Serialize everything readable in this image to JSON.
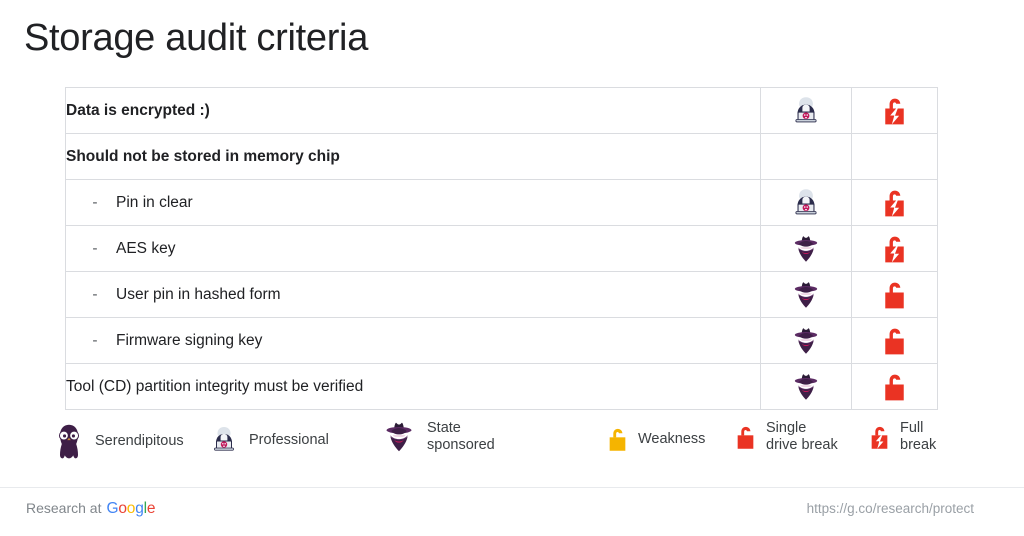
{
  "slide": {
    "title": "Storage audit criteria"
  },
  "table": {
    "rows": [
      {
        "label": "Data is encrypted :)",
        "style": "heading",
        "actor": "professional",
        "lock": "full-break"
      },
      {
        "label": "Should not be stored in memory chip",
        "style": "heading",
        "actor": "none",
        "lock": "none"
      },
      {
        "label": "Pin in clear",
        "style": "sub",
        "dash": "-",
        "actor": "professional",
        "lock": "full-break"
      },
      {
        "label": "AES key",
        "style": "sub",
        "dash": "-",
        "actor": "state",
        "lock": "full-break"
      },
      {
        "label": "User pin in hashed form",
        "style": "sub",
        "dash": "-",
        "actor": "state",
        "lock": "single-drive-break"
      },
      {
        "label": "Firmware signing key",
        "style": "sub",
        "dash": "-",
        "actor": "state",
        "lock": "single-drive-break"
      },
      {
        "label": "Tool (CD) partition integrity must be verified",
        "style": "plain",
        "actor": "state",
        "lock": "single-drive-break"
      }
    ]
  },
  "legend": {
    "items": [
      {
        "icon": "serendipitous-actor-icon",
        "label": "Serendipitous"
      },
      {
        "icon": "professional-actor-icon",
        "label": "Professional"
      },
      {
        "icon": "state-sponsored-actor-icon",
        "label": "State\nsponsored"
      },
      {
        "icon": "weakness-lock-icon",
        "label": "Weakness"
      },
      {
        "icon": "single-drive-break-lock-icon",
        "label": "Single\ndrive break"
      },
      {
        "icon": "full-break-lock-icon",
        "label": "Full\nbreak"
      }
    ]
  },
  "footer": {
    "brand_prefix": "Research at",
    "brand_name": "Google",
    "url": "https://g.co/research/protect"
  },
  "colors": {
    "lock_red": "#EA3323",
    "lock_yellow": "#F5B400",
    "actor_purple": "#5B2B63",
    "actor_navy": "#2B2C4B",
    "skull_red": "#C2185B",
    "border": "#dadce0",
    "text": "#202124",
    "muted": "#80868b"
  }
}
